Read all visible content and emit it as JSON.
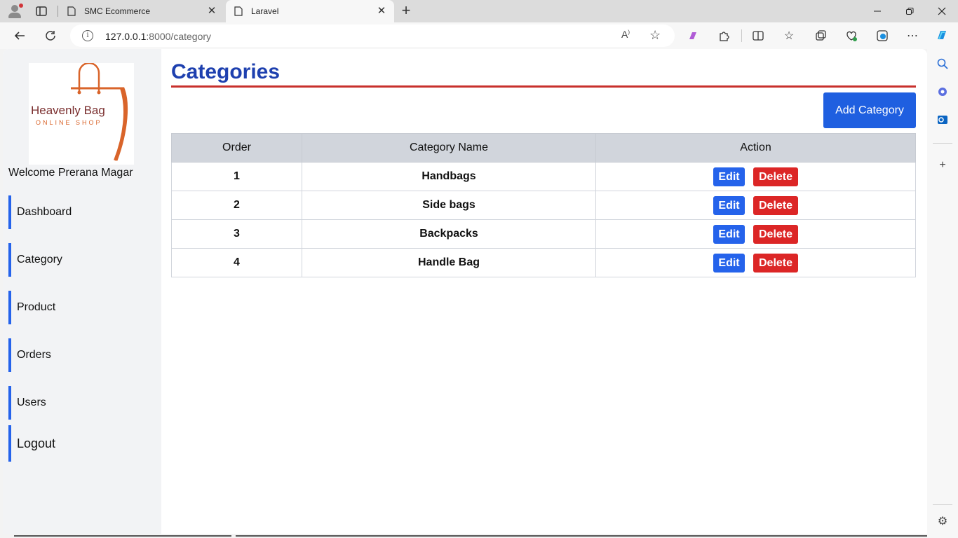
{
  "browser": {
    "tabs": [
      {
        "title": "SMC Ecommerce",
        "active": false
      },
      {
        "title": "Laravel",
        "active": true
      }
    ],
    "address": {
      "host": "127.0.0.1",
      "path": ":8000/category"
    },
    "window_controls": [
      "minimize-icon",
      "restore-icon",
      "close-icon"
    ],
    "toolbar_icons": [
      "back-icon",
      "refresh-icon",
      "read-aloud-icon",
      "favorite-star-icon",
      "copilot-extension-icon",
      "extensions-icon",
      "split-screen-icon",
      "favorites-icon",
      "collections-icon",
      "performance-icon",
      "browser-essentials-icon",
      "more-icon",
      "copilot-icon"
    ],
    "edge_sidebar_icons": [
      "search-icon",
      "copilot-app-icon",
      "outlook-icon",
      "add-icon",
      "settings-icon"
    ]
  },
  "app": {
    "logo": {
      "brand": "Heavenly Bag",
      "tagline": "ONLINE SHOP"
    },
    "welcome": "Welcome Prerana Magar",
    "nav": [
      "Dashboard",
      "Category",
      "Product",
      "Orders",
      "Users",
      "Logout"
    ],
    "page_title": "Categories",
    "add_button": "Add Category",
    "table": {
      "headers": [
        "Order",
        "Category Name",
        "Action"
      ],
      "rows": [
        {
          "order": "1",
          "name": "Handbags"
        },
        {
          "order": "2",
          "name": "Side bags"
        },
        {
          "order": "3",
          "name": "Backpacks"
        },
        {
          "order": "4",
          "name": "Handle Bag"
        }
      ],
      "edit_label": "Edit",
      "delete_label": "Delete"
    }
  },
  "colors": {
    "accent": "#1e40af",
    "button_blue": "#2563eb",
    "button_red": "#dc2626",
    "title_rule": "#c8302c",
    "logo_orange": "#d9642a"
  }
}
